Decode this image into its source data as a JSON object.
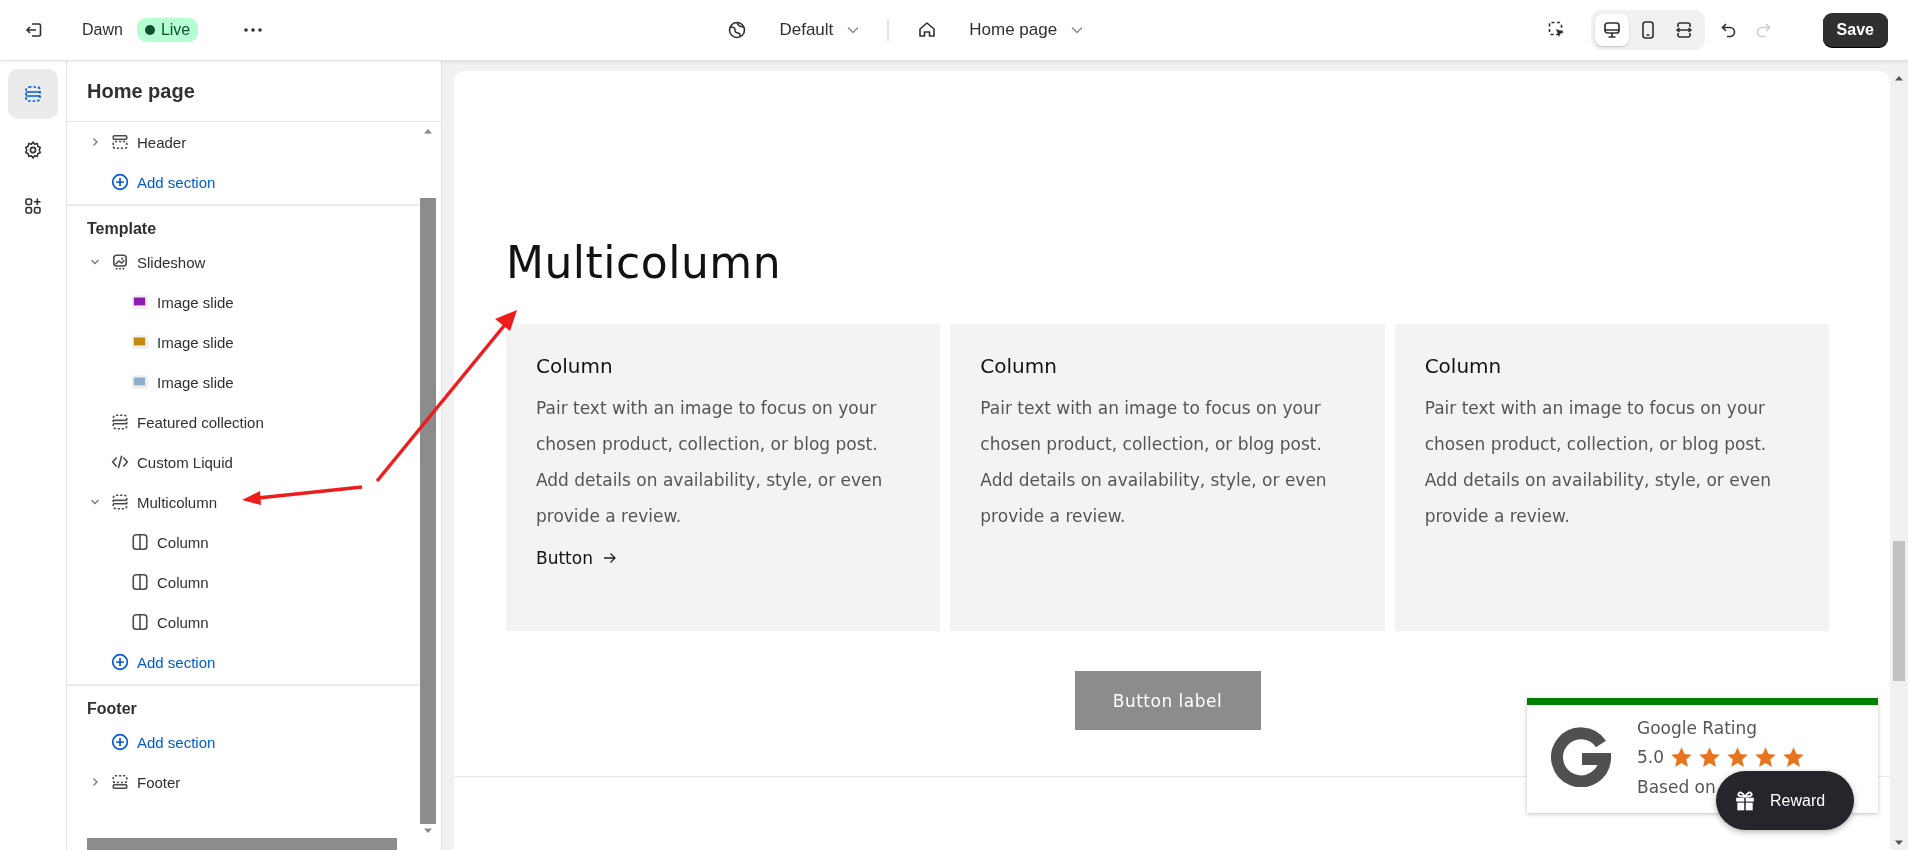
{
  "topbar": {
    "theme_name": "Dawn",
    "status_badge": "Live",
    "theme_menu": "Default",
    "page_menu": "Home page",
    "devices": [
      {
        "kind": "desktop",
        "selected": true
      },
      {
        "kind": "mobile",
        "selected": false
      },
      {
        "kind": "fullwidth",
        "selected": false
      }
    ],
    "redo_disabled": true,
    "save": "Save"
  },
  "rail": [
    {
      "kind": "sections",
      "selected": true
    },
    {
      "kind": "settings",
      "selected": false
    },
    {
      "kind": "apps",
      "selected": false
    }
  ],
  "sidebar": {
    "title": "Home page",
    "groups": [
      {
        "items": [
          {
            "kind": "header",
            "label": "Header",
            "expanded": false
          },
          {
            "kind": "add",
            "label": "Add section"
          }
        ]
      },
      {
        "heading": "Template",
        "items": [
          {
            "kind": "slideshow",
            "label": "Slideshow",
            "expanded": true,
            "children": [
              {
                "kind": "image",
                "color": "#8a1fb0",
                "label": "Image slide"
              },
              {
                "kind": "image",
                "color": "#c08a10",
                "label": "Image slide"
              },
              {
                "kind": "image",
                "color": "#8fb0cc",
                "label": "Image slide"
              }
            ]
          },
          {
            "kind": "section",
            "label": "Featured collection"
          },
          {
            "kind": "code",
            "label": "Custom Liquid"
          },
          {
            "kind": "section",
            "label": "Multicolumn",
            "expanded": true,
            "children": [
              {
                "kind": "column",
                "label": "Column"
              },
              {
                "kind": "column",
                "label": "Column"
              },
              {
                "kind": "column",
                "label": "Column"
              }
            ]
          },
          {
            "kind": "add",
            "label": "Add section"
          }
        ]
      },
      {
        "heading": "Footer",
        "items": [
          {
            "kind": "add",
            "label": "Add section"
          },
          {
            "kind": "footer",
            "label": "Footer",
            "expanded": false
          }
        ]
      }
    ]
  },
  "preview": {
    "heading": "Multicolumn",
    "columns": [
      {
        "title": "Column",
        "text": "Pair text with an image to focus on your chosen product, collection, or blog post. Add details on availability, style, or even provide a review.",
        "link": "Button"
      },
      {
        "title": "Column",
        "text": "Pair text with an image to focus on your chosen product, collection, or blog post. Add details on availability, style, or even provide a review."
      },
      {
        "title": "Column",
        "text": "Pair text with an image to focus on your chosen product, collection, or blog post. Add details on availability, style, or even provide a review."
      }
    ],
    "button": "Button label"
  },
  "rating": {
    "title": "Google Rating",
    "score": "5.0",
    "stars": 5,
    "based_on": "Based on"
  },
  "reward": {
    "label": "Reward"
  }
}
